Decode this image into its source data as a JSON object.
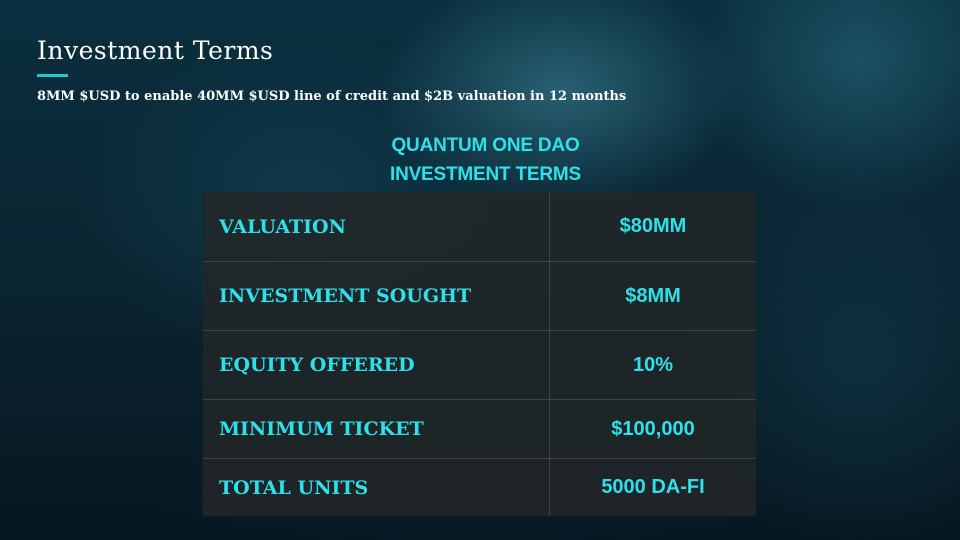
{
  "slide": {
    "title": "Investment Terms",
    "subtitle": "8MM $USD to enable 40MM $USD line of credit and $2B valuation in 12 months"
  },
  "table": {
    "heading_line1": "QUANTUM ONE DAO",
    "heading_line2": "INVESTMENT TERMS",
    "rows": [
      {
        "label": "VALUATION",
        "value": "$80MM"
      },
      {
        "label": "INVESTMENT SOUGHT",
        "value": "$8MM"
      },
      {
        "label": "EQUITY OFFERED",
        "value": "10%"
      },
      {
        "label": "MINIMUM TICKET",
        "value": "$100,000"
      },
      {
        "label": "TOTAL UNITS",
        "value": "5000 DA-FI"
      }
    ]
  },
  "colors": {
    "accent": "#22c5d3",
    "table_text": "#2fe0ea",
    "title_text": "#ffffff"
  }
}
